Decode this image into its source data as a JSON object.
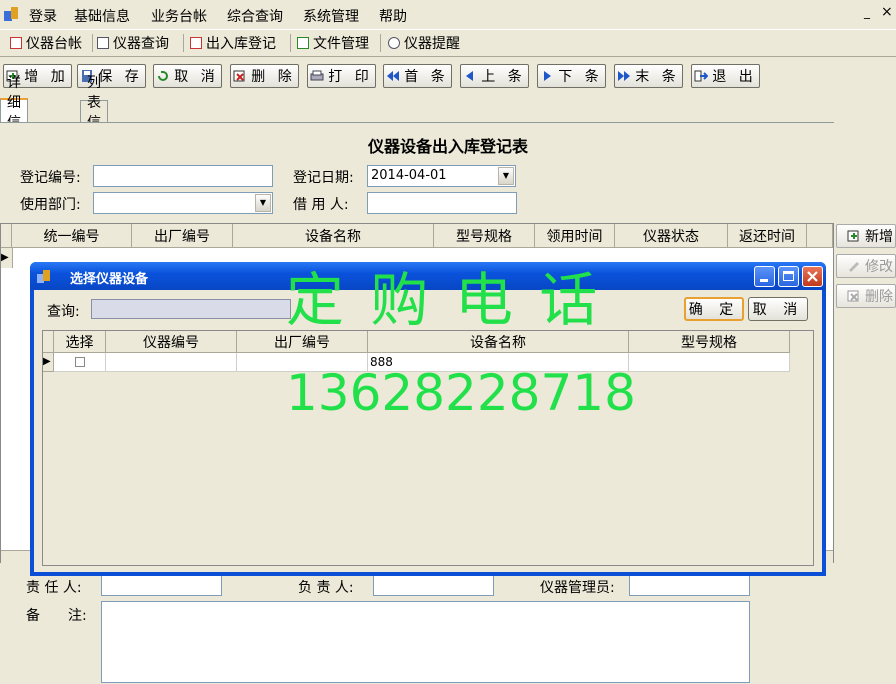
{
  "menu": {
    "items": [
      "登录",
      "基础信息",
      "业务台帐",
      "综合查询",
      "系统管理",
      "帮助"
    ],
    "minimize": "_",
    "close": "×"
  },
  "nav": {
    "items": [
      "仪器台帐",
      "仪器查询",
      "出入库登记",
      "文件管理",
      "仪器提醒"
    ]
  },
  "toolbar": {
    "add": "增 加",
    "save": "保 存",
    "cancel": "取 消",
    "delete": "删 除",
    "print": "打 印",
    "first": "首 条",
    "prev": "上 条",
    "next": "下 条",
    "last": "末 条",
    "exit": "退 出"
  },
  "tabs": [
    "详细信息",
    "列表信息"
  ],
  "form": {
    "title": "仪器设备出入库登记表",
    "reg_no_label": "登记编号:",
    "reg_no_value": "",
    "reg_date_label": "登记日期:",
    "reg_date_value": "2014-04-01",
    "dept_label": "使用部门:",
    "dept_value": "",
    "borrower_label": "借 用 人:",
    "borrower_value": ""
  },
  "grid": {
    "columns": [
      "统一编号",
      "出厂编号",
      "设备名称",
      "型号规格",
      "领用时间",
      "仪器状态",
      "返还时间"
    ]
  },
  "side_buttons": [
    "新增",
    "修改",
    "删除"
  ],
  "footer": {
    "responsible_label": "责 任 人:",
    "manager_label": "负 责 人:",
    "admin_label": "仪器管理员:",
    "remark_label": "备　　注:"
  },
  "dialog": {
    "title": "选择仪器设备",
    "query_label": "查询:",
    "query_value": "",
    "ok": "确 定",
    "cancel": "取 消",
    "columns": [
      "选择",
      "仪器编号",
      "出厂编号",
      "设备名称",
      "型号规格"
    ],
    "rows": [
      {
        "checked": false,
        "instrument_no": "",
        "factory_no": "",
        "device_name": "888",
        "model": ""
      }
    ]
  },
  "watermark": {
    "line1": "定 购 电 话",
    "line2": "13628228718"
  }
}
